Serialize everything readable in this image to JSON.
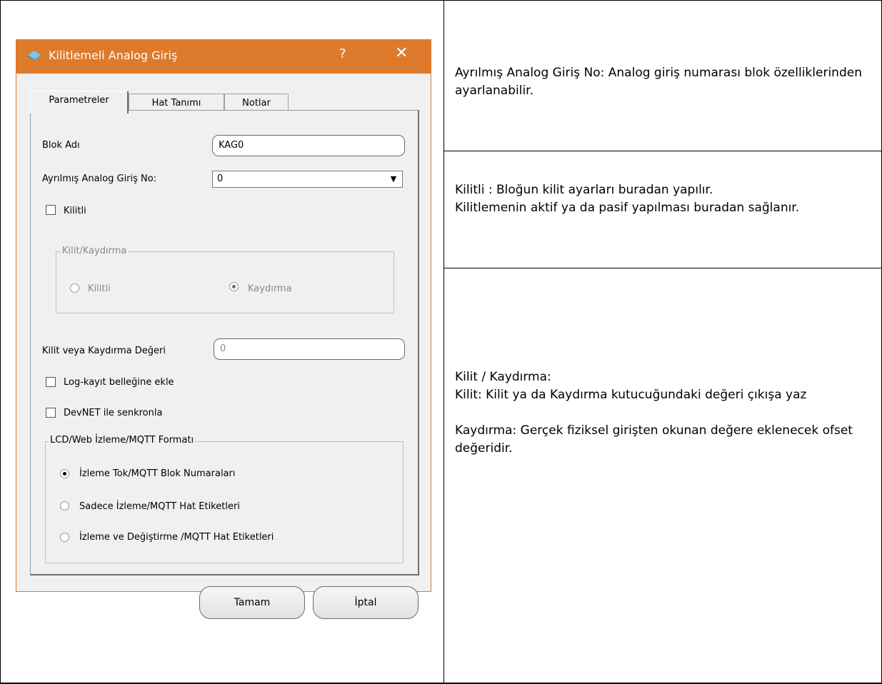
{
  "dialog": {
    "title": "Kilitlemeli Analog Giriş",
    "help_glyph": "?",
    "close_glyph": "✕",
    "tabs": [
      {
        "label": "Parametreler"
      },
      {
        "label": "Hat Tanımı"
      },
      {
        "label": "Notlar"
      }
    ],
    "block_name_label": "Blok Adı",
    "block_name_value": "KAG0",
    "analog_input_label": "Ayrılmış Analog Giriş No:",
    "analog_input_value": "0",
    "locked_checkbox_label": "Kilitli",
    "lock_shift_group_label": "Kilit/Kaydırma",
    "radio_locked_label": "Kilitli",
    "radio_shift_label": "Kaydırma",
    "lock_value_label": "Kilit veya Kaydırma Değeri",
    "lock_value_value": "0",
    "log_checkbox_label": "Log-kayıt belleğine ekle",
    "devnet_checkbox_label": "DevNET ile senkronla",
    "format_group_label": "LCD/Web İzleme/MQTT Formatı",
    "format_options": [
      {
        "label": "İzleme Tok/MQTT Blok Numaraları",
        "selected": true
      },
      {
        "label": "Sadece İzleme/MQTT Hat Etiketleri",
        "selected": false
      },
      {
        "label": "İzleme ve Değiştirme /MQTT Hat Etiketleri",
        "selected": false
      }
    ],
    "ok_label": "Tamam",
    "cancel_label": "İptal"
  },
  "notes": {
    "note1": "Ayrılmış Analog Giriş No:  Analog giriş numarası blok özelliklerinden ayarlanabilir.",
    "note2_line1": "Kilitli :  Bloğun kilit ayarları buradan yapılır.",
    "note2_line2": "Kilitlemenin aktif ya da pasif yapılması buradan sağlanır.",
    "note3_heading": "Kilit / Kaydırma:",
    "note3_lock": "Kilit:  Kilit ya da Kaydırma kutucuğundaki değeri çıkışa yaz",
    "note3_shift": "Kaydırma:  Gerçek fiziksel girişten okunan değere eklenecek ofset değeridir."
  },
  "colors": {
    "title_bar": "#dd7a2c",
    "dialog_bg": "#f0f0f0"
  }
}
